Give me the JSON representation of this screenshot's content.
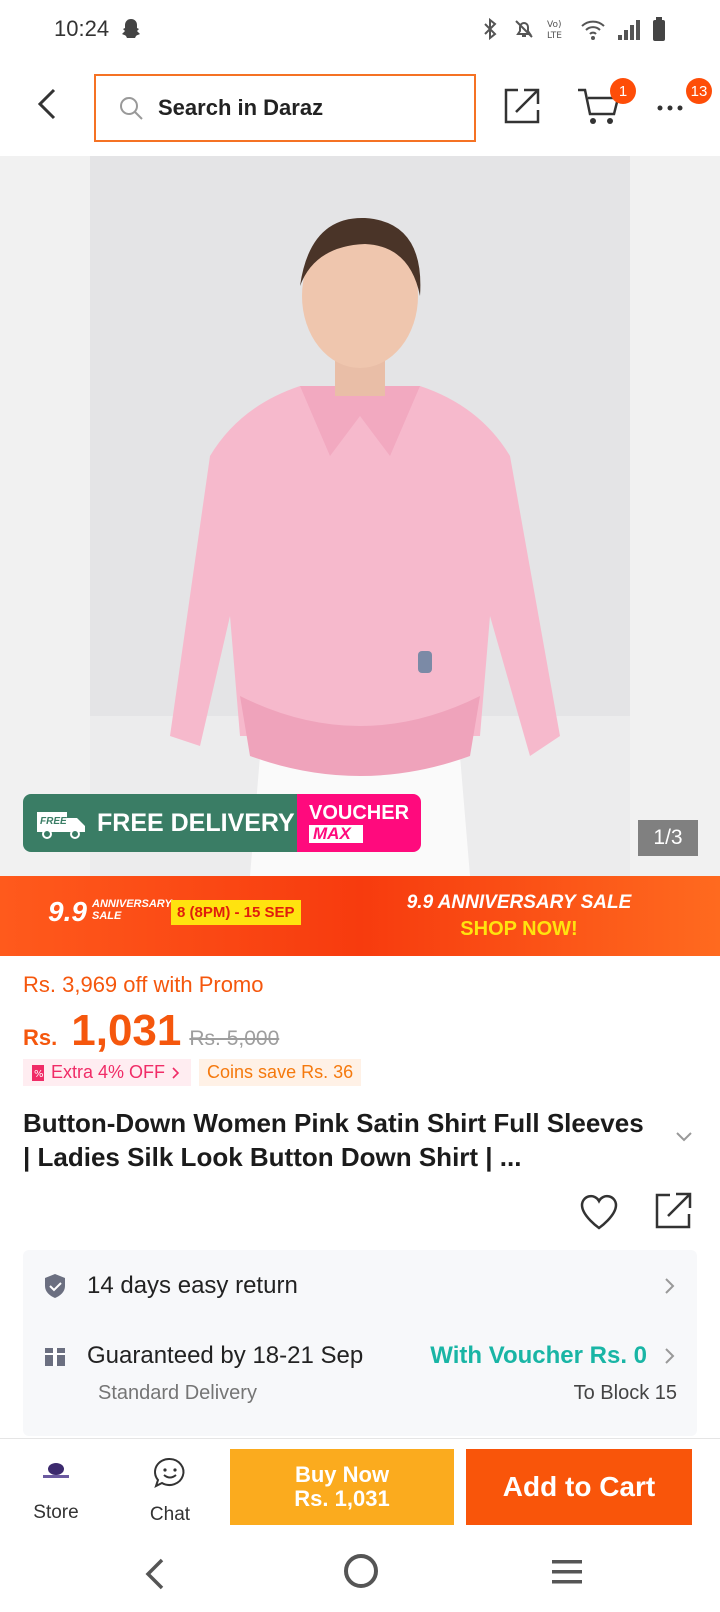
{
  "status_bar": {
    "time": "10:24"
  },
  "header": {
    "search_placeholder": "Search in Daraz",
    "cart_count": "1",
    "more_count": "13"
  },
  "gallery": {
    "free_delivery_label": "FREE DELIVERY",
    "free_badge": "FREE",
    "voucher_label": "VOUCHER",
    "voucher_max": "MAX",
    "counter": "1/3"
  },
  "sale_banner": {
    "logo": "9.9",
    "logo_sub_1": "ANNIVERSARY",
    "logo_sub_2": "SALE",
    "dates": "8 (8PM) - 15 SEP",
    "title": "9.9 ANNIVERSARY SALE",
    "cta": "SHOP NOW!"
  },
  "price": {
    "promo_text": "Rs. 3,969 off with Promo",
    "currency": "Rs.",
    "current": "1,031",
    "original": "Rs. 5,000",
    "extra_off": "Extra 4% OFF",
    "coins": "Coins save Rs. 36"
  },
  "product": {
    "title": "Button-Down Women Pink Satin Shirt Full Sleeves | Ladies Silk Look Button Down Shirt | ..."
  },
  "delivery": {
    "return_label": "14 days easy return",
    "guarantee_label": "Guaranteed by 18-21 Sep",
    "voucher_text": "With Voucher Rs. 0",
    "method": "Standard Delivery",
    "location": "To Block 15"
  },
  "bottom_bar": {
    "store_label": "Store",
    "chat_label": "Chat",
    "buy_now_label": "Buy Now",
    "buy_now_price": "Rs. 1,031",
    "add_to_cart_label": "Add to Cart"
  },
  "colors": {
    "brand_orange": "#f57224",
    "buy_now": "#fbab1e",
    "add_to_cart": "#f9550a",
    "voucher_teal": "#19b5a5",
    "free_delivery_green": "#3a7d65",
    "voucher_pink": "#ff0a7d"
  }
}
